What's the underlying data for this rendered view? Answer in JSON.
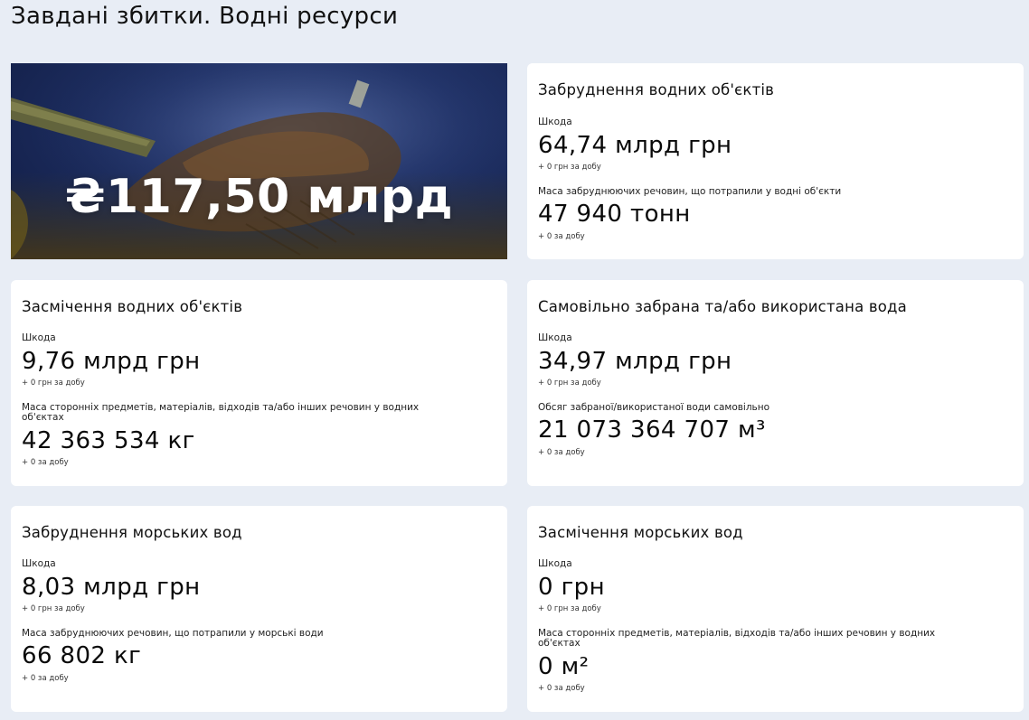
{
  "page": {
    "title": "Завдані збитки. Водні ресурси"
  },
  "hero": {
    "value": "₴117,50 млрд"
  },
  "cards": [
    {
      "title": "Забруднення водних об'єктів",
      "damage_label": "Шкода",
      "damage_value": "64,74 млрд грн",
      "damage_delta": "+ 0 грн за добу",
      "metric_label": "Маса забруднюючих речовин, що потрапили у водні об'єкти",
      "metric_value": "47 940 тонн",
      "metric_delta": "+ 0 за добу"
    },
    {
      "title": "Засмічення водних об'єктів",
      "damage_label": "Шкода",
      "damage_value": "9,76 млрд грн",
      "damage_delta": "+ 0 грн за добу",
      "metric_label": "Маса сторонніх предметів, матеріалів, відходів та/або інших речовин у водних об'єктах",
      "metric_value": "42 363 534 кг",
      "metric_delta": "+ 0 за добу"
    },
    {
      "title": "Самовільно забрана та/або використана вода",
      "damage_label": "Шкода",
      "damage_value": "34,97 млрд грн",
      "damage_delta": "+ 0 грн за добу",
      "metric_label": "Обсяг забраної/використаної води самовільно",
      "metric_value": "21 073 364 707 м³",
      "metric_delta": "+ 0 за добу"
    },
    {
      "title": "Забруднення морських вод",
      "damage_label": "Шкода",
      "damage_value": "8,03 млрд грн",
      "damage_delta": "+ 0 грн за добу",
      "metric_label": "Маса забруднюючих речовин, що потрапили у морські води",
      "metric_value": "66 802 кг",
      "metric_delta": "+ 0 за добу"
    },
    {
      "title": "Засмічення морських вод",
      "damage_label": "Шкода",
      "damage_value": "0 грн",
      "damage_delta": "+ 0 грн за добу",
      "metric_label": "Маса сторонніх предметів, матеріалів, відходів та/або інших речовин у водних об'єктах",
      "metric_value": "0 м²",
      "metric_delta": "+ 0 за добу"
    }
  ]
}
